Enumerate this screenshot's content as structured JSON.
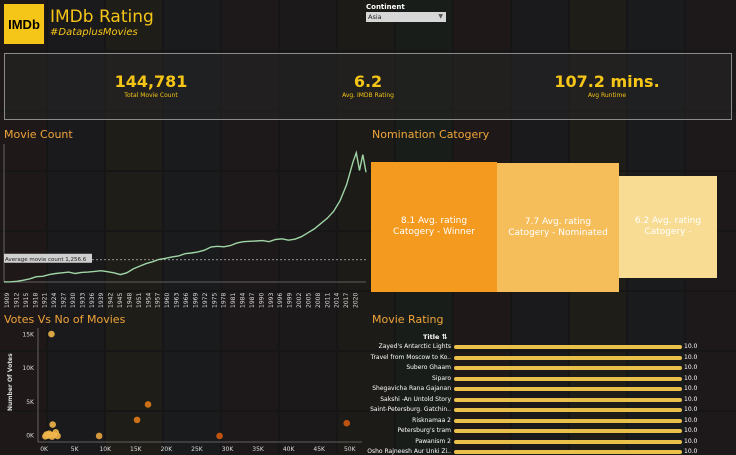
{
  "header": {
    "logo_text": "IMDb",
    "title": "IMDb Rating",
    "subtitle": "#DataplusMovies"
  },
  "filter": {
    "label": "Continent",
    "selected": "Asia"
  },
  "kpis": [
    {
      "value": "144,781",
      "label": "Total Movie Count"
    },
    {
      "value": "6.2",
      "label": "Avg. IMDB Rating"
    },
    {
      "value": "107.2 mins.",
      "label": "Avg Runtime"
    }
  ],
  "sections": {
    "movie_count": "Movie Count",
    "nomination": "Nomination Catogery",
    "votes": "Votes Vs No of Movies",
    "rating": "Movie Rating"
  },
  "nomination_bars": [
    {
      "line1": "8.1 Avg. rating",
      "line2": "Catogery - Winner",
      "color": "#f39a1f"
    },
    {
      "line1": "7.7 Avg. rating",
      "line2": "Catogery - Nominated",
      "color": "#f5be5b"
    },
    {
      "line1": "6.2 Avg. rating",
      "line2": "Catogery -",
      "color": "#f8dc94"
    }
  ],
  "rating_list": {
    "header": "Title",
    "rows": [
      {
        "title": "Zayed's Antarctic Lights",
        "value": "10.0"
      },
      {
        "title": "Travel from Moscow to Ko..",
        "value": "10.0"
      },
      {
        "title": "Subero Ghaam",
        "value": "10.0"
      },
      {
        "title": "Siparo",
        "value": "10.0"
      },
      {
        "title": "Shegavicha Rana Gajanan",
        "value": "10.0"
      },
      {
        "title": "Sakshi -An Untold Story",
        "value": "10.0"
      },
      {
        "title": "Saint-Petersburg. Gatchin..",
        "value": "10.0"
      },
      {
        "title": "Risknamaa 2",
        "value": "10.0"
      },
      {
        "title": "Petersburg's tram",
        "value": "10.0"
      },
      {
        "title": "Pawanism 2",
        "value": "10.0"
      },
      {
        "title": "Osho Rajneesh Aur Unki Zi..",
        "value": "10.0"
      }
    ]
  },
  "chart_data": [
    {
      "type": "line",
      "title": "Movie Count",
      "reference_line_label": "Average movie count 1,256.6",
      "reference_value": 1256.6,
      "x_tick_labels": [
        "1909",
        "1912",
        "1915",
        "1918",
        "1921",
        "1924",
        "1927",
        "1930",
        "1933",
        "1936",
        "1939",
        "1942",
        "1945",
        "1948",
        "1951",
        "1954",
        "1957",
        "1960",
        "1963",
        "1966",
        "1969",
        "1972",
        "1975",
        "1978",
        "1981",
        "1984",
        "1987",
        "1990",
        "1993",
        "1996",
        "1999",
        "2002",
        "2005",
        "2008",
        "2011",
        "2014",
        "2017",
        "2020"
      ],
      "x": [
        1909,
        1911,
        1913,
        1915,
        1917,
        1919,
        1921,
        1923,
        1925,
        1927,
        1929,
        1931,
        1933,
        1935,
        1937,
        1939,
        1941,
        1943,
        1945,
        1947,
        1949,
        1951,
        1953,
        1955,
        1957,
        1959,
        1961,
        1963,
        1965,
        1967,
        1969,
        1971,
        1973,
        1975,
        1977,
        1979,
        1981,
        1983,
        1985,
        1987,
        1989,
        1991,
        1993,
        1995,
        1997,
        1999,
        2001,
        2003,
        2005,
        2007,
        2009,
        2011,
        2013,
        2015,
        2017,
        2018,
        2019,
        2020,
        2021
      ],
      "y": [
        5,
        10,
        40,
        100,
        180,
        300,
        320,
        420,
        480,
        520,
        560,
        480,
        540,
        560,
        600,
        640,
        580,
        520,
        420,
        520,
        740,
        900,
        1040,
        1150,
        1280,
        1340,
        1420,
        1470,
        1600,
        1640,
        1700,
        1800,
        1980,
        2020,
        1990,
        2060,
        2200,
        2280,
        2300,
        2320,
        2340,
        2280,
        2400,
        2440,
        2360,
        2420,
        2560,
        2780,
        3000,
        3300,
        3600,
        4000,
        4600,
        5500,
        6800,
        7300,
        6300,
        7200,
        6200
      ],
      "ylim": [
        0,
        7800
      ]
    },
    {
      "type": "scatter",
      "title": "Votes Vs No of Movies",
      "ylabel": "Number Of Votes",
      "x_tick_labels": [
        "0K",
        "5K",
        "10K",
        "15K",
        "20K",
        "25K",
        "30K",
        "35K",
        "40K",
        "45K",
        "50K"
      ],
      "y_tick_labels": [
        "0K",
        "5K",
        "10K",
        "15K"
      ],
      "xlim": [
        -1000,
        52000
      ],
      "ylim": [
        -1000,
        16000
      ],
      "points": [
        {
          "x": 1200,
          "y": 15100,
          "color": "#f0b54a"
        },
        {
          "x": 1400,
          "y": 1600,
          "color": "#f0b54a"
        },
        {
          "x": 1900,
          "y": 450,
          "color": "#f0b54a"
        },
        {
          "x": 800,
          "y": 250,
          "color": "#f0b54a"
        },
        {
          "x": 400,
          "y": 120,
          "color": "#f0b54a"
        },
        {
          "x": 200,
          "y": -150,
          "color": "#f0b54a"
        },
        {
          "x": 1000,
          "y": 100,
          "color": "#f0b54a"
        },
        {
          "x": 1600,
          "y": 80,
          "color": "#f0b54a"
        },
        {
          "x": 2200,
          "y": -100,
          "color": "#f0b54a"
        },
        {
          "x": 600,
          "y": -50,
          "color": "#f0b54a"
        },
        {
          "x": 1300,
          "y": -200,
          "color": "#f0b54a"
        },
        {
          "x": 9000,
          "y": -100,
          "color": "#e8a63d"
        },
        {
          "x": 15200,
          "y": 2300,
          "color": "#e07b1a"
        },
        {
          "x": 17000,
          "y": 4600,
          "color": "#e07b1a"
        },
        {
          "x": 28700,
          "y": -100,
          "color": "#d05a10"
        },
        {
          "x": 49500,
          "y": 1800,
          "color": "#d05a10"
        }
      ]
    }
  ]
}
